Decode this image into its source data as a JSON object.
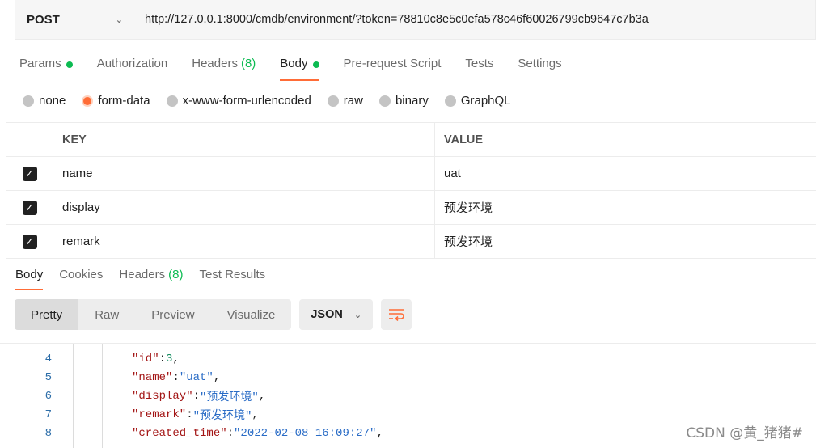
{
  "request": {
    "method": "POST",
    "url": "http://127.0.0.1:8000/cmdb/environment/?token=78810c8e5c0efa578c46f60026799cb9647c7b3a"
  },
  "request_tabs": [
    {
      "label": "Params",
      "dot": true
    },
    {
      "label": "Authorization"
    },
    {
      "label": "Headers",
      "count": "(8)"
    },
    {
      "label": "Body",
      "dot": true,
      "active": true
    },
    {
      "label": "Pre-request Script"
    },
    {
      "label": "Tests"
    },
    {
      "label": "Settings"
    }
  ],
  "body_types": [
    {
      "label": "none",
      "selected": false
    },
    {
      "label": "form-data",
      "selected": true
    },
    {
      "label": "x-www-form-urlencoded",
      "selected": false
    },
    {
      "label": "raw",
      "selected": false
    },
    {
      "label": "binary",
      "selected": false
    },
    {
      "label": "GraphQL",
      "selected": false
    }
  ],
  "params_table": {
    "headers": {
      "key": "KEY",
      "value": "VALUE"
    },
    "rows": [
      {
        "checked": true,
        "key": "name",
        "value": "uat"
      },
      {
        "checked": true,
        "key": "display",
        "value": "预发环境"
      },
      {
        "checked": true,
        "key": "remark",
        "value": "预发环境"
      }
    ]
  },
  "response_tabs": [
    {
      "label": "Body",
      "active": true
    },
    {
      "label": "Cookies"
    },
    {
      "label": "Headers",
      "count": "(8)"
    },
    {
      "label": "Test Results"
    }
  ],
  "view_modes": [
    "Pretty",
    "Raw",
    "Preview",
    "Visualize"
  ],
  "format": "JSON",
  "code_lines": [
    {
      "n": "4",
      "key": "\"id\"",
      "sep": ": ",
      "val": "3",
      "kind": "num",
      "tail": ","
    },
    {
      "n": "5",
      "key": "\"name\"",
      "sep": ": ",
      "val": "\"uat\"",
      "kind": "str",
      "tail": ","
    },
    {
      "n": "6",
      "key": "\"display\"",
      "sep": ": ",
      "val": "\"预发环境\"",
      "kind": "str",
      "tail": ","
    },
    {
      "n": "7",
      "key": "\"remark\"",
      "sep": ": ",
      "val": "\"预发环境\"",
      "kind": "str",
      "tail": ","
    },
    {
      "n": "8",
      "key": "\"created_time\"",
      "sep": ": ",
      "val": "\"2022-02-08 16:09:27\"",
      "kind": "str",
      "tail": ","
    }
  ],
  "watermark": "CSDN @黄_猪猪#",
  "colors": {
    "accent": "#ff6c37",
    "green": "#0cbb52"
  }
}
